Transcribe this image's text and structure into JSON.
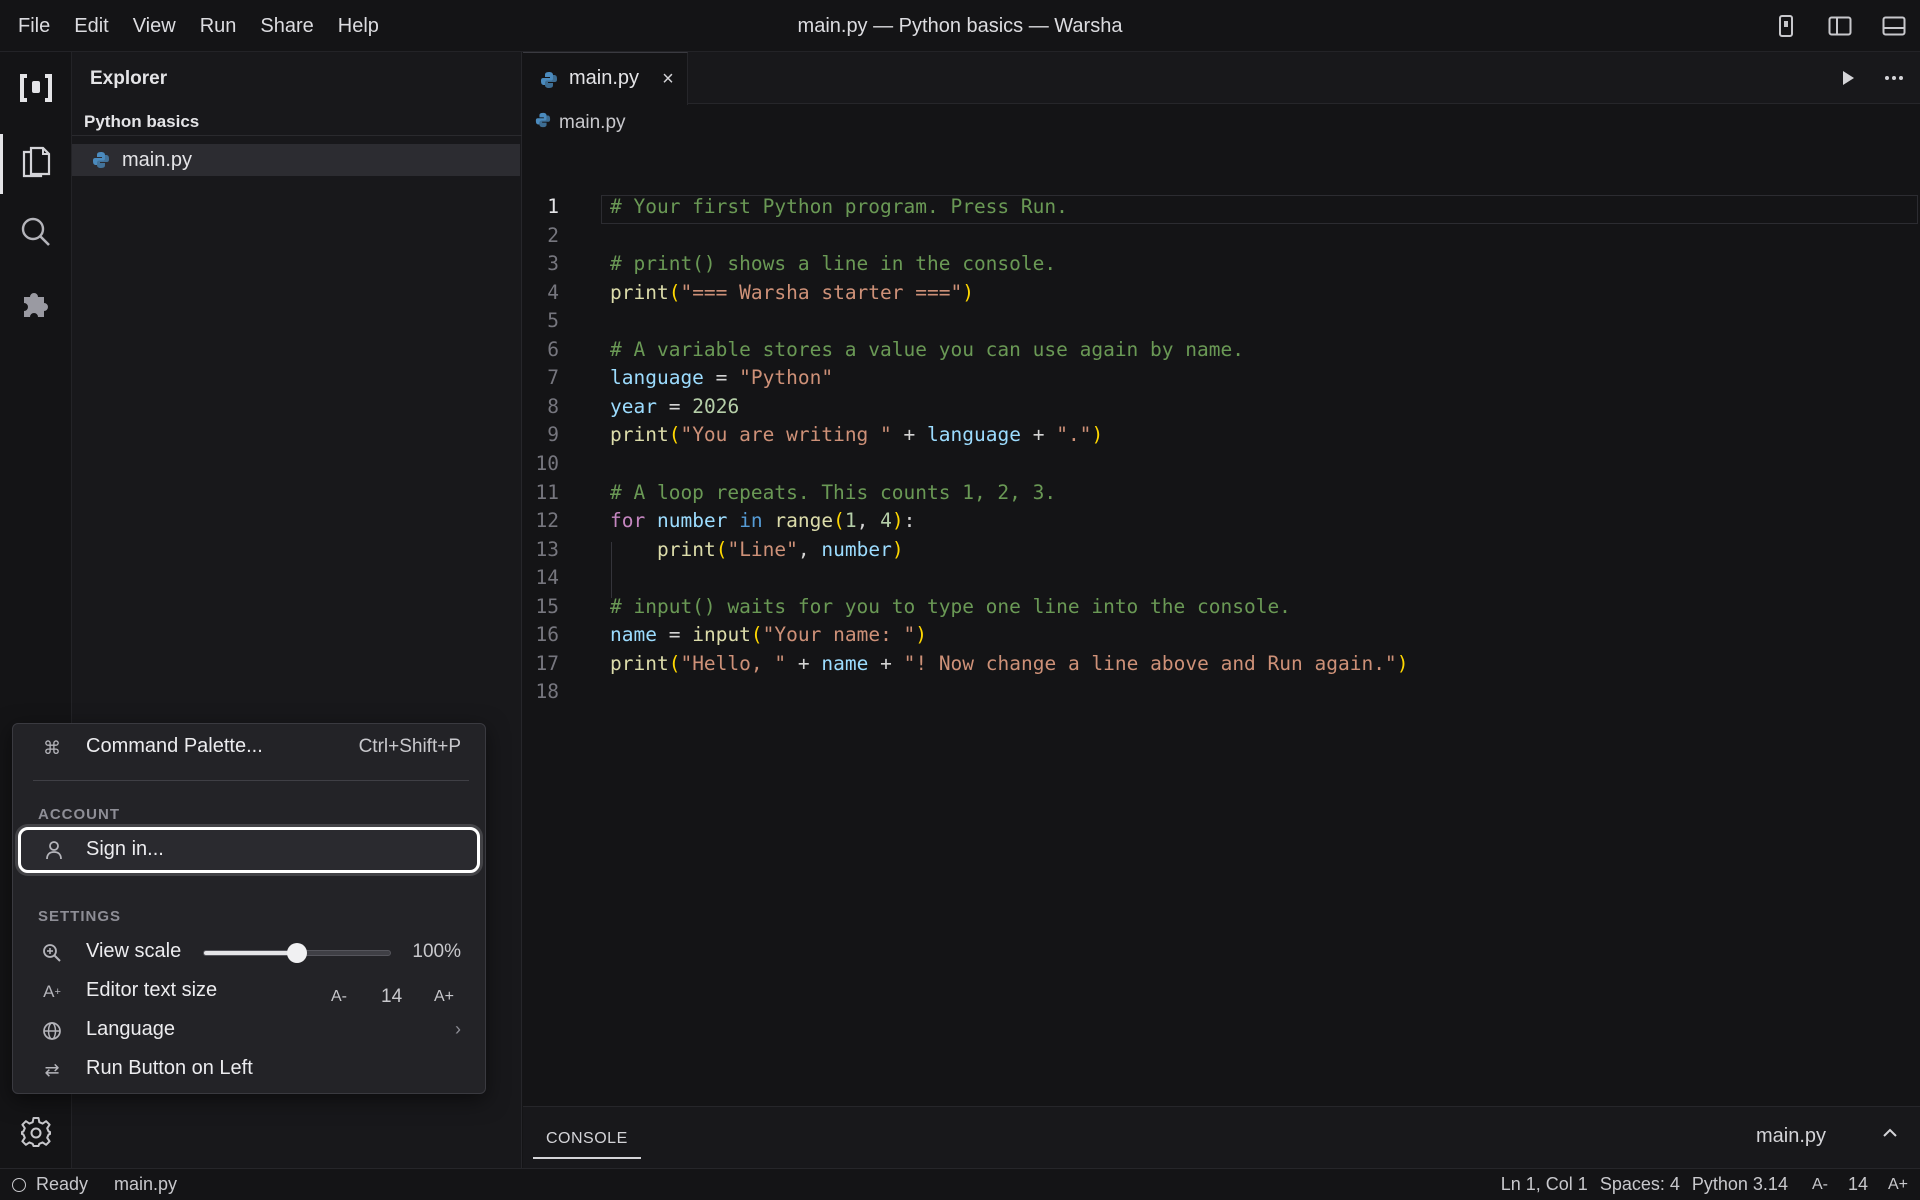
{
  "menubar": {
    "menus": [
      "File",
      "Edit",
      "View",
      "Run",
      "Share",
      "Help"
    ],
    "window_title": "main.py — Python basics — Warsha"
  },
  "explorer": {
    "title": "Explorer",
    "project": "Python basics",
    "files": [
      "main.py"
    ]
  },
  "editor": {
    "tab_label": "main.py",
    "breadcrumb": "main.py",
    "current_line": 1,
    "lines": [
      "# Your first Python program. Press Run.",
      "",
      "# print() shows a line in the console.",
      "print(\"=== Warsha starter ===\")",
      "",
      "# A variable stores a value you can use again by name.",
      "language = \"Python\"",
      "year = 2026",
      "print(\"You are writing \" + language + \".\")",
      "",
      "# A loop repeats. This counts 1, 2, 3.",
      "for number in range(1, 4):",
      "    print(\"Line\", number)",
      "",
      "# input() waits for you to type one line into the console.",
      "name = input(\"Your name: \")",
      "print(\"Hello, \" + name + \"! Now change a line above and Run again.\")",
      ""
    ]
  },
  "console": {
    "tab_label": "CONSOLE",
    "file": "main.py"
  },
  "popup": {
    "command_palette": {
      "label": "Command Palette...",
      "shortcut": "Ctrl+Shift+P"
    },
    "account_header": "ACCOUNT",
    "sign_in": "Sign in...",
    "settings_header": "SETTINGS",
    "view_scale": {
      "label": "View scale",
      "value_text": "100%",
      "level": 0.5
    },
    "editor_text_size": {
      "label": "Editor text size",
      "decrease": "A-",
      "value": "14",
      "increase": "A+"
    },
    "language": {
      "label": "Language"
    },
    "run_button": {
      "label": "Run Button on Left"
    }
  },
  "statusbar": {
    "status": "Ready",
    "file": "main.py",
    "position": "Ln 1, Col 1",
    "spaces": "Spaces: 4",
    "language": "Python 3.14",
    "font_decrease": "A-",
    "font_size": "14",
    "font_increase": "A+"
  },
  "colors": {
    "accent": "#ffffff",
    "comment": "#6a9955",
    "string": "#ce9178",
    "function": "#dcdcaa",
    "variable": "#9cdcfe",
    "keyword": "#c586c0"
  },
  "icons": {
    "logo": "warsha-logo-icon",
    "files": "files-icon",
    "search": "search-icon",
    "extensions": "puzzle-icon",
    "settings": "gear-icon"
  }
}
